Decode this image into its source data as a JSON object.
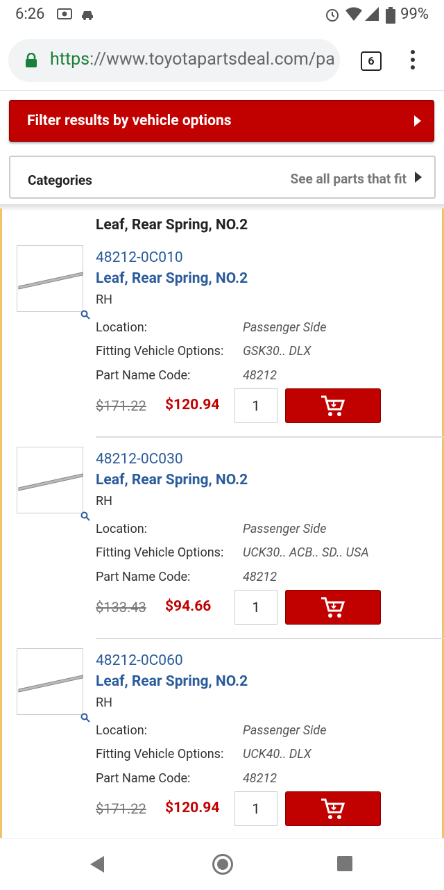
{
  "status": {
    "time": "6:26",
    "battery": "99%"
  },
  "browser": {
    "url_scheme": "https",
    "url_rest": "://www.toyotapartsdeal.com/pa",
    "tab_count": "6"
  },
  "filter": {
    "label": "Filter results by vehicle options"
  },
  "categories": {
    "label": "Categories",
    "see_all": "See all parts that fit"
  },
  "section_title": "Leaf, Rear Spring, NO.2",
  "labels": {
    "location": "Location:",
    "fitting": "Fitting Vehicle Options:",
    "name_code": "Part Name Code:"
  },
  "parts": [
    {
      "number": "48212-0C010",
      "name": "Leaf, Rear Spring, NO.2",
      "side": "RH",
      "location": "Passenger Side",
      "fitting": "GSK30.. DLX",
      "name_code": "48212",
      "old_price": "$171.22",
      "price": "$120.94",
      "qty": "1"
    },
    {
      "number": "48212-0C030",
      "name": "Leaf, Rear Spring, NO.2",
      "side": "RH",
      "location": "Passenger Side",
      "fitting": "UCK30.. ACB.. SD.. USA",
      "name_code": "48212",
      "old_price": "$133.43",
      "price": "$94.66",
      "qty": "1"
    },
    {
      "number": "48212-0C060",
      "name": "Leaf, Rear Spring, NO.2",
      "side": "RH",
      "location": "Passenger Side",
      "fitting": "UCK40.. DLX",
      "name_code": "48212",
      "old_price": "$171.22",
      "price": "$120.94",
      "qty": "1"
    }
  ],
  "colors": {
    "brand_red": "#c10000",
    "link_blue": "#2a5b9a",
    "accent_gold": "#f0c36a"
  }
}
